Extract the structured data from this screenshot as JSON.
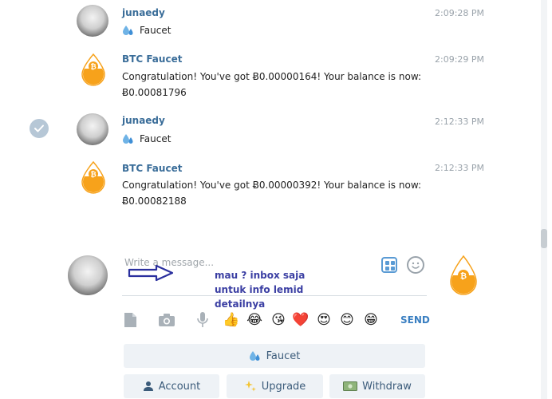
{
  "messages": [
    {
      "sender": "junaedy",
      "time": "2:09:28 PM",
      "type": "faucet",
      "text": "Faucet"
    },
    {
      "sender": "BTC Faucet",
      "time": "2:09:29 PM",
      "type": "text",
      "line1": "Congratulation! You've got Ƀ0.00000164! Your balance is now:",
      "line2": "Ƀ0.00081796"
    },
    {
      "sender": "junaedy",
      "time": "2:12:33 PM",
      "type": "faucet",
      "text": "Faucet"
    },
    {
      "sender": "BTC Faucet",
      "time": "2:12:33 PM",
      "type": "text",
      "line1": "Congratulation! You've got Ƀ0.00000392! Your balance is now:",
      "line2": "Ƀ0.00082188"
    }
  ],
  "compose": {
    "placeholder": "Write a message...",
    "send_label": "SEND"
  },
  "annotation": {
    "lines": [
      "mau ? inbox saja",
      "untuk info lemid",
      "detailnya"
    ]
  },
  "toolbar": {
    "emojis": [
      "👍",
      "😂",
      "😘",
      "❤️",
      "😍",
      "😊",
      "😁"
    ]
  },
  "keyboard": {
    "faucet": "Faucet",
    "account": "Account",
    "upgrade": "Upgrade",
    "withdraw": "Withdraw"
  },
  "colors": {
    "sender": "#3a6d99",
    "accent": "#3a7fc1",
    "button_bg": "#eef2f6",
    "bitcoin_orange": "#f7a21b"
  },
  "icons": {
    "faucet": "droplets-icon",
    "check": "check-circle-icon",
    "bitcoin": "bitcoin-drop-icon"
  }
}
